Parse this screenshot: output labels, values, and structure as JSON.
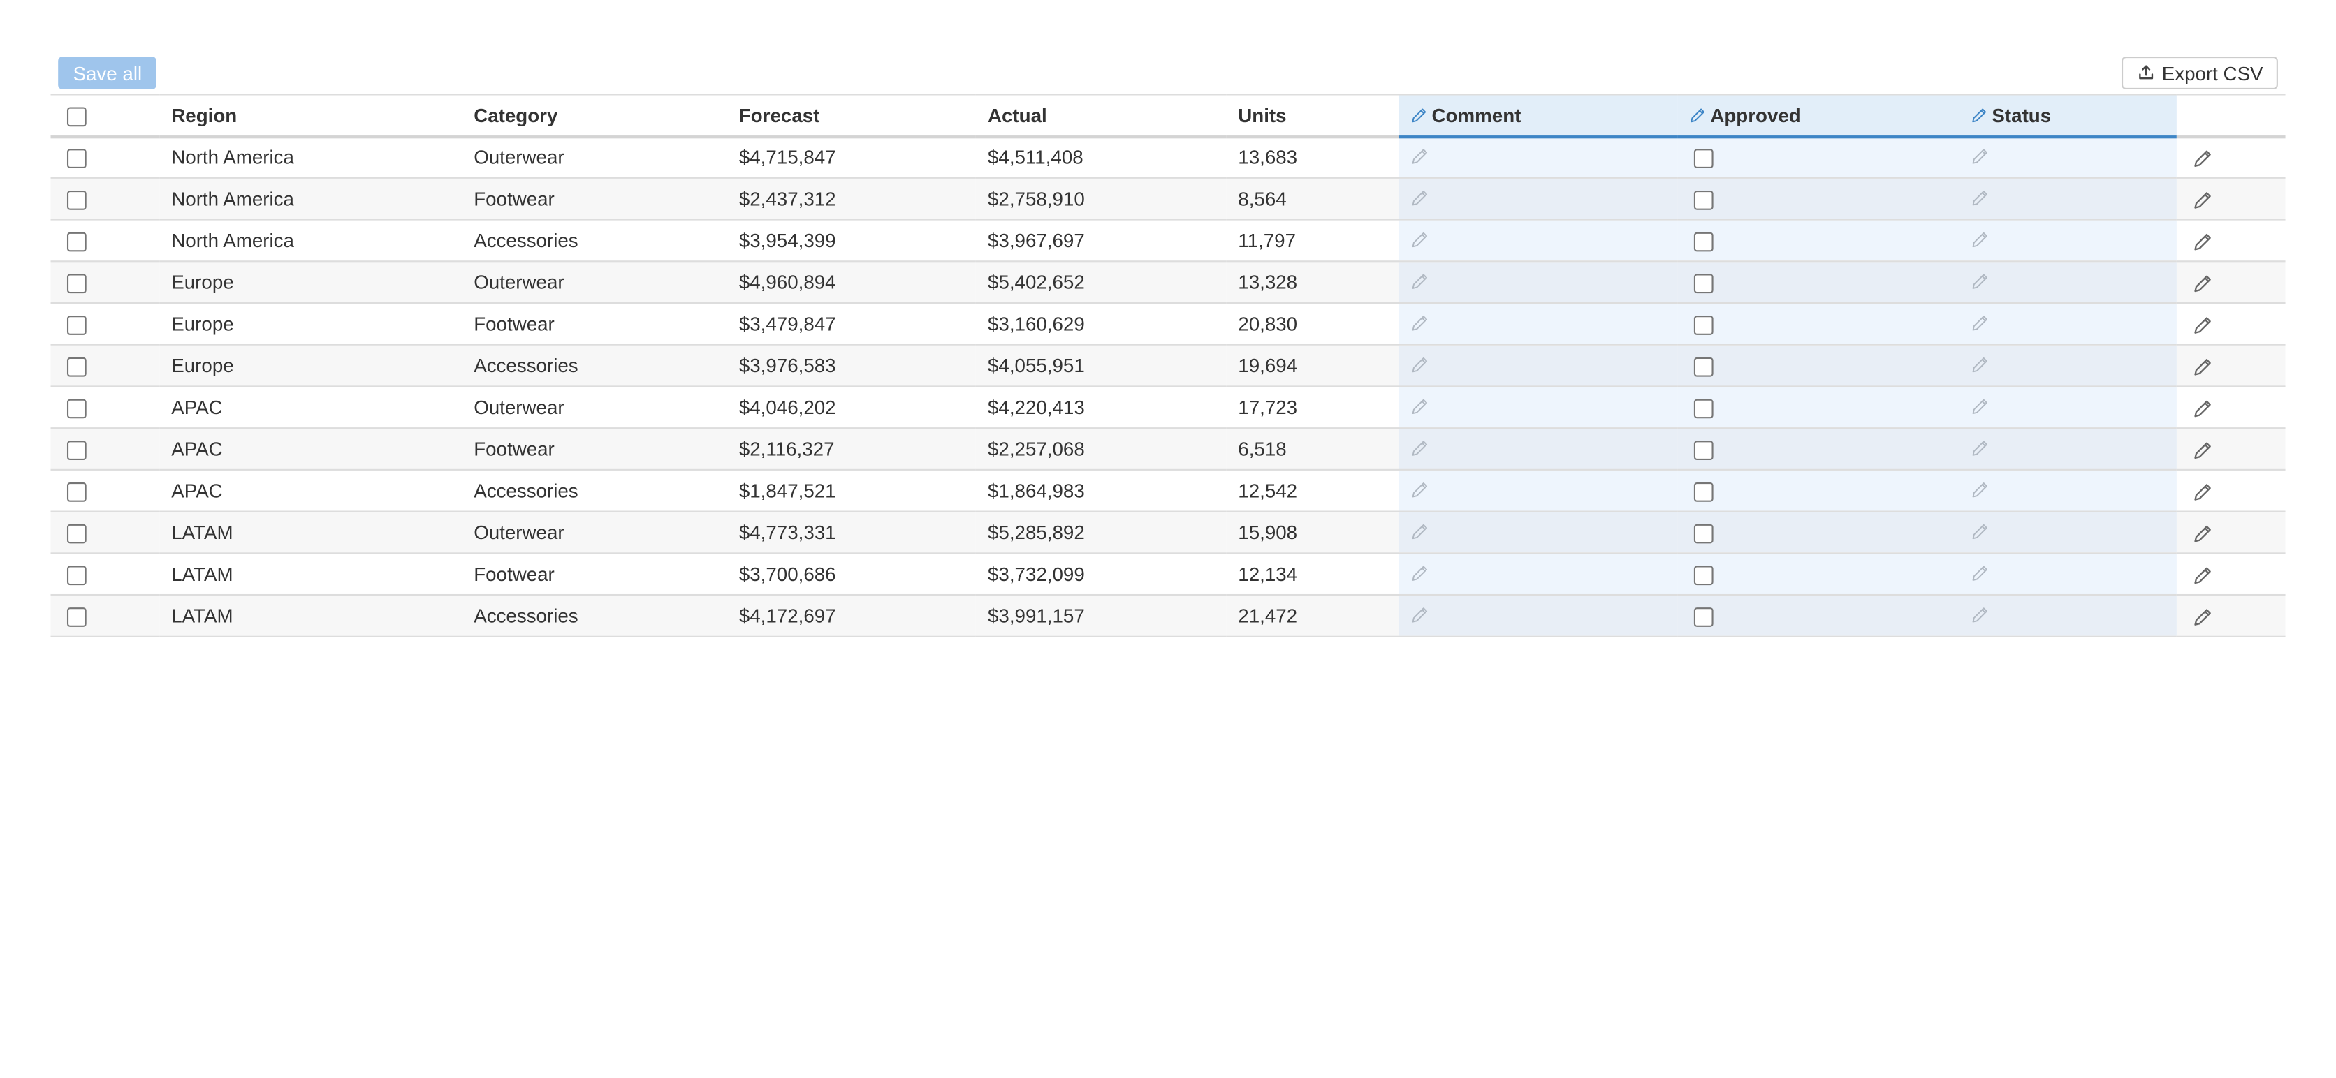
{
  "toolbar": {
    "save_all_label": "Save all",
    "export_label": "Export CSV",
    "export_icon": "upload-icon"
  },
  "columns": [
    {
      "label": "",
      "key": "select",
      "editable": false
    },
    {
      "label": "Region",
      "key": "region",
      "editable": false
    },
    {
      "label": "Category",
      "key": "category",
      "editable": false
    },
    {
      "label": "Forecast",
      "key": "forecast",
      "editable": false
    },
    {
      "label": "Actual",
      "key": "actual",
      "editable": false
    },
    {
      "label": "Units",
      "key": "units",
      "editable": false
    },
    {
      "label": "Comment",
      "key": "comment",
      "editable": true
    },
    {
      "label": "Approved",
      "key": "approved",
      "editable": true
    },
    {
      "label": "Status",
      "key": "status",
      "editable": true
    },
    {
      "label": "",
      "key": "row_action",
      "editable": false
    }
  ],
  "rows": [
    {
      "region": "North America",
      "category": "Outerwear",
      "forecast": "$4,715,847",
      "actual": "$4,511,408",
      "units": "13,683",
      "comment": "",
      "approved": false,
      "status": ""
    },
    {
      "region": "North America",
      "category": "Footwear",
      "forecast": "$2,437,312",
      "actual": "$2,758,910",
      "units": "8,564",
      "comment": "",
      "approved": false,
      "status": ""
    },
    {
      "region": "North America",
      "category": "Accessories",
      "forecast": "$3,954,399",
      "actual": "$3,967,697",
      "units": "11,797",
      "comment": "",
      "approved": false,
      "status": ""
    },
    {
      "region": "Europe",
      "category": "Outerwear",
      "forecast": "$4,960,894",
      "actual": "$5,402,652",
      "units": "13,328",
      "comment": "",
      "approved": false,
      "status": ""
    },
    {
      "region": "Europe",
      "category": "Footwear",
      "forecast": "$3,479,847",
      "actual": "$3,160,629",
      "units": "20,830",
      "comment": "",
      "approved": false,
      "status": ""
    },
    {
      "region": "Europe",
      "category": "Accessories",
      "forecast": "$3,976,583",
      "actual": "$4,055,951",
      "units": "19,694",
      "comment": "",
      "approved": false,
      "status": ""
    },
    {
      "region": "APAC",
      "category": "Outerwear",
      "forecast": "$4,046,202",
      "actual": "$4,220,413",
      "units": "17,723",
      "comment": "",
      "approved": false,
      "status": ""
    },
    {
      "region": "APAC",
      "category": "Footwear",
      "forecast": "$2,116,327",
      "actual": "$2,257,068",
      "units": "6,518",
      "comment": "",
      "approved": false,
      "status": ""
    },
    {
      "region": "APAC",
      "category": "Accessories",
      "forecast": "$1,847,521",
      "actual": "$1,864,983",
      "units": "12,542",
      "comment": "",
      "approved": false,
      "status": ""
    },
    {
      "region": "LATAM",
      "category": "Outerwear",
      "forecast": "$4,773,331",
      "actual": "$5,285,892",
      "units": "15,908",
      "comment": "",
      "approved": false,
      "status": ""
    },
    {
      "region": "LATAM",
      "category": "Footwear",
      "forecast": "$3,700,686",
      "actual": "$3,732,099",
      "units": "12,134",
      "comment": "",
      "approved": false,
      "status": ""
    },
    {
      "region": "LATAM",
      "category": "Accessories",
      "forecast": "$4,172,697",
      "actual": "$3,991,157",
      "units": "21,472",
      "comment": "",
      "approved": false,
      "status": ""
    }
  ],
  "icons": {
    "editable_header": "pencil-icon",
    "editable_cell": "pencil-icon",
    "row_edit": "pencil-icon"
  },
  "colors": {
    "accent": "#3d85c6",
    "save_button_bg": "#9fc5ec",
    "editable_header_bg": "#e2eef9",
    "editable_cell_bg": "#eef5fd"
  }
}
